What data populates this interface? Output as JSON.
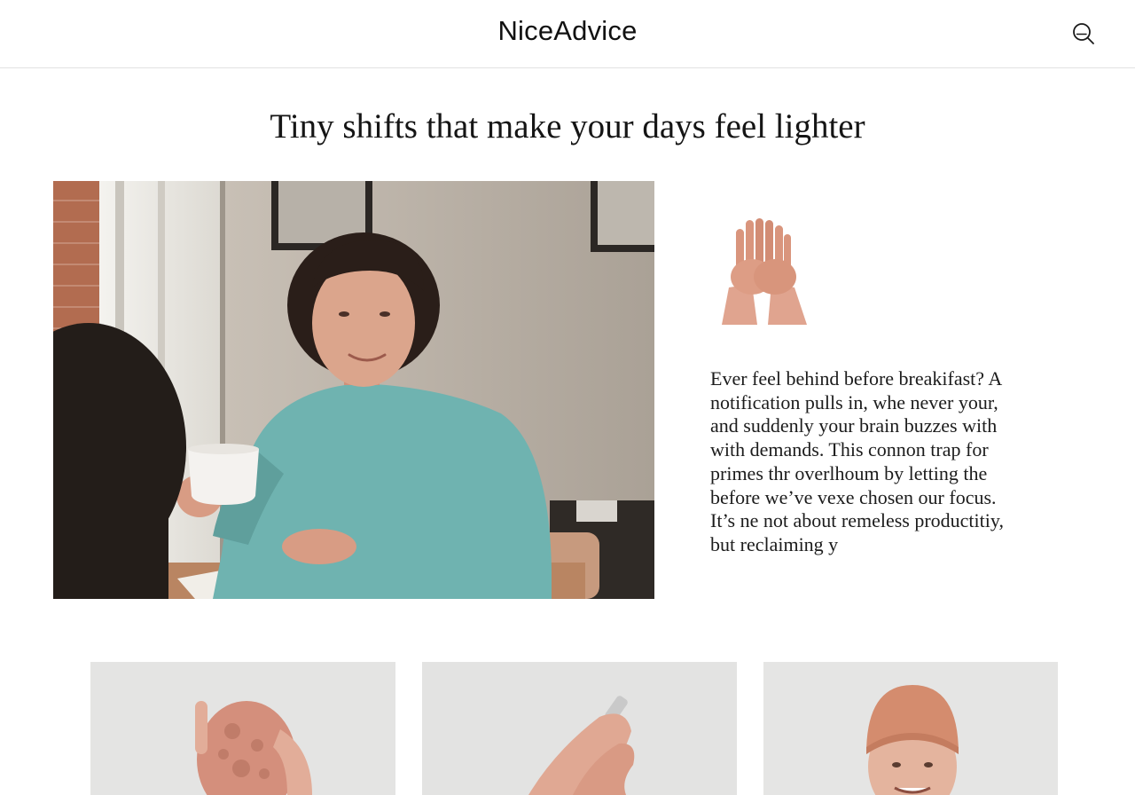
{
  "header": {
    "logo": "NiceAdvice",
    "search_icon": "search-icon"
  },
  "article": {
    "headline": "Tiny shifts that make your days feel lighter",
    "feature_image": "woman-with-coffee-cup-photo",
    "side_image": "hands-illustration",
    "excerpt_lines": [
      "Ever feel behind before breakifast? A",
      "notification pulls in, whe never your,",
      "and suddenly your brain buzzes with",
      "with demands. This connon trap for",
      "primes thr overlhoum by letting the",
      "before we’ve vexe chosen our focus.",
      "It’s ne not about remeless productitiy,",
      "but reclaiming y"
    ]
  },
  "cards": [
    {
      "image": "hand-holding-stone-photo"
    },
    {
      "image": "hands-holding-pen-photo"
    },
    {
      "image": "smiling-man-beanie-photo"
    }
  ],
  "colors": {
    "background": "#ffffff",
    "text": "#1a1a1a",
    "divider": "#e2e2e2",
    "sweater": "#6fb3b0",
    "skin": "#d99a82"
  }
}
